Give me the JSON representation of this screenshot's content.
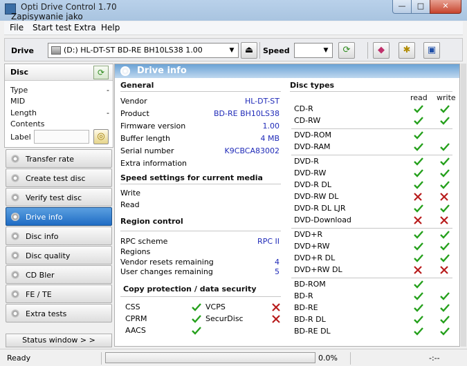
{
  "window": {
    "title": "Opti Drive Control 1.70",
    "subtitle": "Zapisywanie jako",
    "controls": {
      "minimize": "—",
      "maximize": "□",
      "close": "✕"
    }
  },
  "menu": [
    "File",
    "Start test",
    "Extra",
    "Help"
  ],
  "toolbar": {
    "drive_label": "Drive",
    "drive_value": "(D:)   HL-DT-ST BD-RE  BH10LS38 1.00",
    "speed_label": "Speed",
    "speed_value": "",
    "icons": {
      "refresh": "refresh-icon",
      "eject": "eject-icon",
      "erase": "eraser-icon",
      "config": "settings-icon",
      "save": "save-icon"
    }
  },
  "disc": {
    "title": "Disc",
    "rows": [
      {
        "label": "Type",
        "value": "-"
      },
      {
        "label": "MID",
        "value": ""
      },
      {
        "label": "Length",
        "value": "-"
      },
      {
        "label": "Contents",
        "value": ""
      }
    ],
    "label_field": "Label",
    "label_value": ""
  },
  "nav": [
    {
      "label": "Transfer rate",
      "active": false
    },
    {
      "label": "Create test disc",
      "active": false
    },
    {
      "label": "Verify test disc",
      "active": false
    },
    {
      "label": "Drive info",
      "active": true
    },
    {
      "label": "Disc info",
      "active": false
    },
    {
      "label": "Disc quality",
      "active": false
    },
    {
      "label": "CD Bler",
      "active": false
    },
    {
      "label": "FE / TE",
      "active": false
    },
    {
      "label": "Extra tests",
      "active": false
    }
  ],
  "status_window_label": "Status window > >",
  "drive_info": {
    "title": "Drive info",
    "general": {
      "title": "General",
      "rows": [
        {
          "label": "Vendor",
          "value": "HL-DT-ST"
        },
        {
          "label": "Product",
          "value": "BD-RE  BH10LS38"
        },
        {
          "label": "Firmware version",
          "value": "1.00"
        },
        {
          "label": "Buffer length",
          "value": "4 MB"
        },
        {
          "label": "Serial number",
          "value": "K9CBCA83002"
        },
        {
          "label": "Extra information",
          "value": ""
        }
      ]
    },
    "speed": {
      "title": "Speed settings for current media",
      "rows": [
        {
          "label": "Write",
          "value": ""
        },
        {
          "label": "Read",
          "value": ""
        }
      ]
    },
    "region": {
      "title": "Region control",
      "rows": [
        {
          "label": "RPC scheme",
          "value": "RPC II"
        },
        {
          "label": "Regions",
          "value": ""
        },
        {
          "label": "Vendor resets remaining",
          "value": "4"
        },
        {
          "label": "User changes remaining",
          "value": "5"
        }
      ]
    },
    "copy": {
      "title": "Copy protection / data security",
      "items": [
        {
          "label": "CSS",
          "supported": true
        },
        {
          "label": "VCPS",
          "supported": false
        },
        {
          "label": "CPRM",
          "supported": true
        },
        {
          "label": "SecurDisc",
          "supported": false
        },
        {
          "label": "AACS",
          "supported": true
        }
      ]
    },
    "disc_types": {
      "title": "Disc types",
      "read_label": "read",
      "write_label": "write",
      "groups": [
        [
          {
            "name": "CD-R",
            "read": true,
            "write": true
          },
          {
            "name": "CD-RW",
            "read": true,
            "write": true
          }
        ],
        [
          {
            "name": "DVD-ROM",
            "read": true,
            "write": null
          },
          {
            "name": "DVD-RAM",
            "read": true,
            "write": true
          }
        ],
        [
          {
            "name": "DVD-R",
            "read": true,
            "write": true
          },
          {
            "name": "DVD-RW",
            "read": true,
            "write": true
          },
          {
            "name": "DVD-R DL",
            "read": true,
            "write": true
          },
          {
            "name": "DVD-RW DL",
            "read": false,
            "write": false
          },
          {
            "name": "DVD-R DL LJR",
            "read": true,
            "write": true
          },
          {
            "name": "DVD-Download",
            "read": false,
            "write": false
          }
        ],
        [
          {
            "name": "DVD+R",
            "read": true,
            "write": true
          },
          {
            "name": "DVD+RW",
            "read": true,
            "write": true
          },
          {
            "name": "DVD+R DL",
            "read": true,
            "write": true
          },
          {
            "name": "DVD+RW DL",
            "read": false,
            "write": false
          }
        ],
        [
          {
            "name": "BD-ROM",
            "read": true,
            "write": null
          },
          {
            "name": "BD-R",
            "read": true,
            "write": true
          },
          {
            "name": "BD-RE",
            "read": true,
            "write": true
          },
          {
            "name": "BD-R DL",
            "read": true,
            "write": true
          },
          {
            "name": "BD-RE DL",
            "read": true,
            "write": true
          }
        ]
      ]
    }
  },
  "statusbar": {
    "status": "Ready",
    "progress_percent": 0,
    "progress_text": "0.0%",
    "time": "-:--"
  },
  "colors": {
    "check": "#25a01c",
    "cross": "#b81c1c",
    "value": "#1f2ab8",
    "accent": "#1f6cc4"
  }
}
